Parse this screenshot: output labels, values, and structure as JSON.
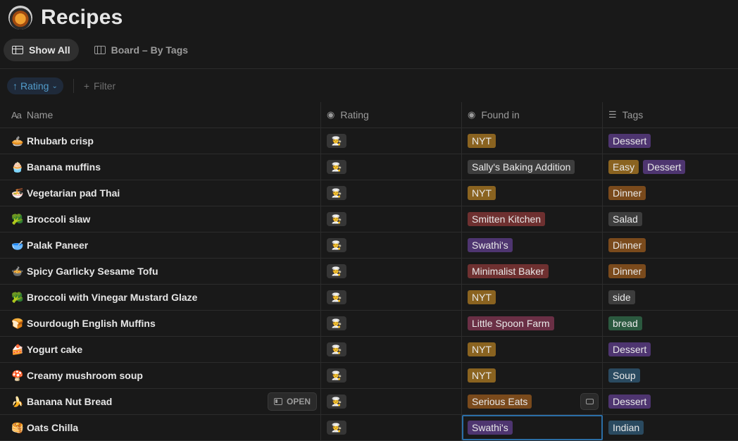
{
  "page": {
    "title": "Recipes",
    "icon": "recipe-bowl-icon"
  },
  "views": [
    {
      "label": "Show All",
      "icon": "table-icon",
      "active": true
    },
    {
      "label": "Board – By Tags",
      "icon": "board-icon",
      "active": false
    }
  ],
  "toolbar": {
    "sort_label": "Rating",
    "filter_label": "Filter"
  },
  "columns": {
    "name": "Name",
    "rating": "Rating",
    "found": "Found in",
    "tags": "Tags"
  },
  "tag_colors": {
    "brown": "#8a6320",
    "gray": "#3d3d3d",
    "orange": "#7a4a1c",
    "red": "#6e3030",
    "purple": "#4e3570",
    "pink": "#6a2f45",
    "green": "#2b593f",
    "blue": "#2a4a60"
  },
  "rows": [
    {
      "emoji": "🥧",
      "name": "Rhubarb crisp",
      "rating": "🧑‍🍳",
      "found": {
        "label": "NYT",
        "color": "#8a6320"
      },
      "tags": [
        {
          "label": "Dessert",
          "color": "#4e3570"
        }
      ]
    },
    {
      "emoji": "🧁",
      "name": "Banana muffins",
      "rating": "🧑‍🍳",
      "found": {
        "label": "Sally's Baking Addition",
        "color": "#3d3d3d"
      },
      "tags": [
        {
          "label": "Easy",
          "color": "#8a6320"
        },
        {
          "label": "Dessert",
          "color": "#4e3570"
        }
      ]
    },
    {
      "emoji": "🍜",
      "name": "Vegetarian pad Thai",
      "rating": "🧑‍🍳",
      "found": {
        "label": "NYT",
        "color": "#8a6320"
      },
      "tags": [
        {
          "label": "Dinner",
          "color": "#7a4a1c"
        }
      ]
    },
    {
      "emoji": "🥦",
      "name": "Broccoli slaw",
      "rating": "🧑‍🍳",
      "found": {
        "label": "Smitten Kitchen",
        "color": "#6e3030"
      },
      "tags": [
        {
          "label": "Salad",
          "color": "#3d3d3d"
        }
      ]
    },
    {
      "emoji": "🥣",
      "name": "Palak Paneer",
      "rating": "🧑‍🍳",
      "found": {
        "label": "Swathi's",
        "color": "#4e3570"
      },
      "tags": [
        {
          "label": "Dinner",
          "color": "#7a4a1c"
        }
      ]
    },
    {
      "emoji": "🍲",
      "name": "Spicy Garlicky Sesame Tofu",
      "rating": "🧑‍🍳",
      "found": {
        "label": "Minimalist Baker",
        "color": "#6e3030"
      },
      "tags": [
        {
          "label": "Dinner",
          "color": "#7a4a1c"
        }
      ]
    },
    {
      "emoji": "🥦",
      "name": "Broccoli with Vinegar Mustard Glaze",
      "rating": "🧑‍🍳",
      "found": {
        "label": "NYT",
        "color": "#8a6320"
      },
      "tags": [
        {
          "label": "side",
          "color": "#3d3d3d"
        }
      ]
    },
    {
      "emoji": "🍞",
      "name": "Sourdough English Muffins",
      "rating": "🧑‍🍳",
      "found": {
        "label": "Little Spoon Farm",
        "color": "#6a2f45"
      },
      "tags": [
        {
          "label": "bread",
          "color": "#2b593f"
        }
      ]
    },
    {
      "emoji": "🍰",
      "name": "Yogurt cake",
      "rating": "🧑‍🍳",
      "found": {
        "label": "NYT",
        "color": "#8a6320"
      },
      "tags": [
        {
          "label": "Dessert",
          "color": "#4e3570"
        }
      ]
    },
    {
      "emoji": "🍄",
      "name": "Creamy mushroom soup",
      "rating": "🧑‍🍳",
      "found": {
        "label": "NYT",
        "color": "#8a6320"
      },
      "tags": [
        {
          "label": "Soup",
          "color": "#2a4a60"
        }
      ]
    },
    {
      "emoji": "🍌",
      "name": "Banana Nut Bread",
      "rating": "🧑‍🍳",
      "found": {
        "label": "Serious Eats",
        "color": "#7a4a1c"
      },
      "tags": [
        {
          "label": "Dessert",
          "color": "#4e3570"
        }
      ],
      "hover_open": "OPEN",
      "show_comment": true
    },
    {
      "emoji": "🥞",
      "name": "Oats Chilla",
      "rating": "🧑‍🍳",
      "found": {
        "label": "Swathi's",
        "color": "#4e3570"
      },
      "tags": [
        {
          "label": "Indian",
          "color": "#2a4a60"
        }
      ],
      "selected_found": true
    }
  ]
}
